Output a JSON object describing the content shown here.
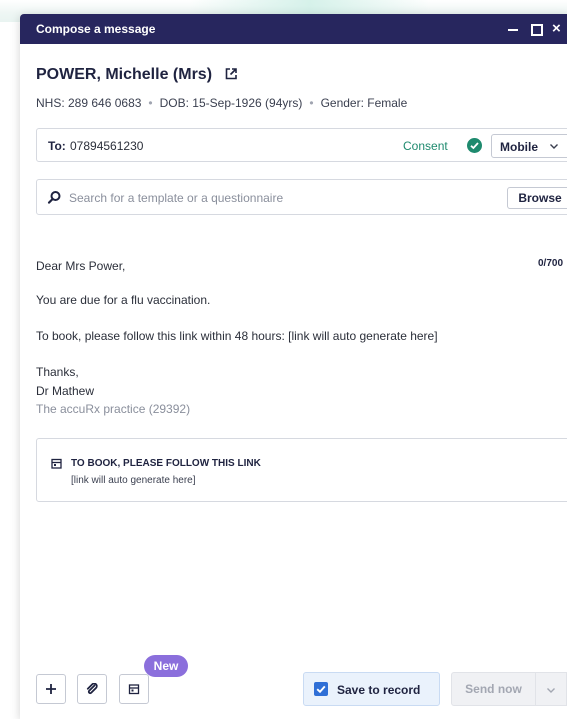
{
  "window": {
    "title": "Compose a message",
    "controls": {
      "minimize": "minimize",
      "maximize": "maximize",
      "close": "×"
    }
  },
  "patient": {
    "name": "POWER, Michelle (Mrs)",
    "nhs": "NHS: 289 646 0683",
    "dob": "DOB: 15-Sep-1926 (94yrs)",
    "gender": "Gender: Female"
  },
  "recipient": {
    "label": "To:",
    "value": "07894561230",
    "consent": "Consent",
    "channel": "Mobile",
    "colors": {
      "consent": "#1e8a6e"
    }
  },
  "template_search": {
    "placeholder": "Search for a template or a questionnaire",
    "value": "",
    "browse_label": "Browse"
  },
  "message": {
    "char_count": "0/700",
    "greeting": "Dear Mrs Power,",
    "line1": "You are due for a flu vaccination.",
    "line2": "To book, please follow this link within 48 hours: [link will auto generate here]",
    "signoff": "Thanks,",
    "signer": "Dr Mathew",
    "practice": "The accuRx practice (29392)"
  },
  "link_card": {
    "heading": "TO BOOK, PLEASE FOLLOW THIS LINK",
    "sub": "[link will auto generate here]"
  },
  "footer": {
    "new_badge": "New",
    "save_to_record": "Save to record",
    "save_checked": true,
    "send_now": "Send now",
    "icons": [
      "plus-icon",
      "paperclip-icon",
      "calendar-icon",
      "chevron-down-icon"
    ],
    "colors": {
      "title_bar": "#27265e",
      "accent": "#2f6fd6",
      "badge": "#8b6fdc"
    }
  }
}
